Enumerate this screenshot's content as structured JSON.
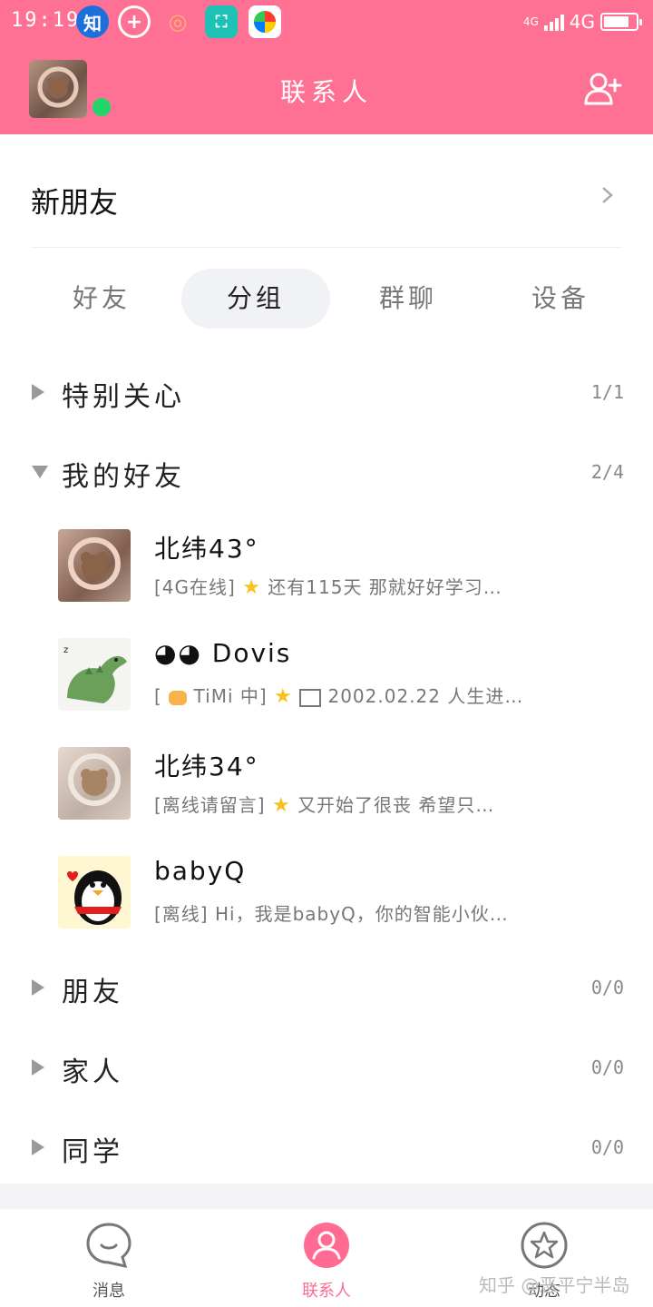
{
  "status_bar": {
    "time": "19:19",
    "network_small": "4G",
    "network": "4G",
    "battery_level": 0.8
  },
  "header": {
    "title": "联系人"
  },
  "new_friends": {
    "label": "新朋友"
  },
  "tabs": [
    {
      "label": "好友",
      "active": false
    },
    {
      "label": "分组",
      "active": true
    },
    {
      "label": "群聊",
      "active": false
    },
    {
      "label": "设备",
      "active": false
    }
  ],
  "groups": [
    {
      "name": "特别关心",
      "count": "1/1",
      "expanded": false
    },
    {
      "name": "我的好友",
      "count": "2/4",
      "expanded": true
    },
    {
      "name": "朋友",
      "count": "0/0",
      "expanded": false
    },
    {
      "name": "家人",
      "count": "0/0",
      "expanded": false
    },
    {
      "name": "同学",
      "count": "0/0",
      "expanded": false
    }
  ],
  "friends": [
    {
      "name": "北纬43°",
      "status_prefix": "[4G在线]",
      "status_text": "还有115天 那就好好学习…"
    },
    {
      "name": "Dovis",
      "status_prefix": "[",
      "status_app": "TiMi 中]",
      "status_text": "2002.02.22 人生进…"
    },
    {
      "name": "北纬34°",
      "status_prefix": "[离线请留言]",
      "status_text": "又开始了很丧 希望只…"
    },
    {
      "name": "babyQ",
      "status_prefix": "[离线]",
      "status_text": "Hi，我是babyQ，你的智能小伙…"
    }
  ],
  "bottom_nav": [
    {
      "label": "消息",
      "icon": "chat-bubble-icon",
      "active": false
    },
    {
      "label": "联系人",
      "icon": "person-icon",
      "active": true
    },
    {
      "label": "动态",
      "icon": "star-icon",
      "active": false
    }
  ],
  "watermark": "知乎 @恶平宁半岛",
  "colors": {
    "accent": "#ff7194",
    "online": "#22d66b"
  }
}
